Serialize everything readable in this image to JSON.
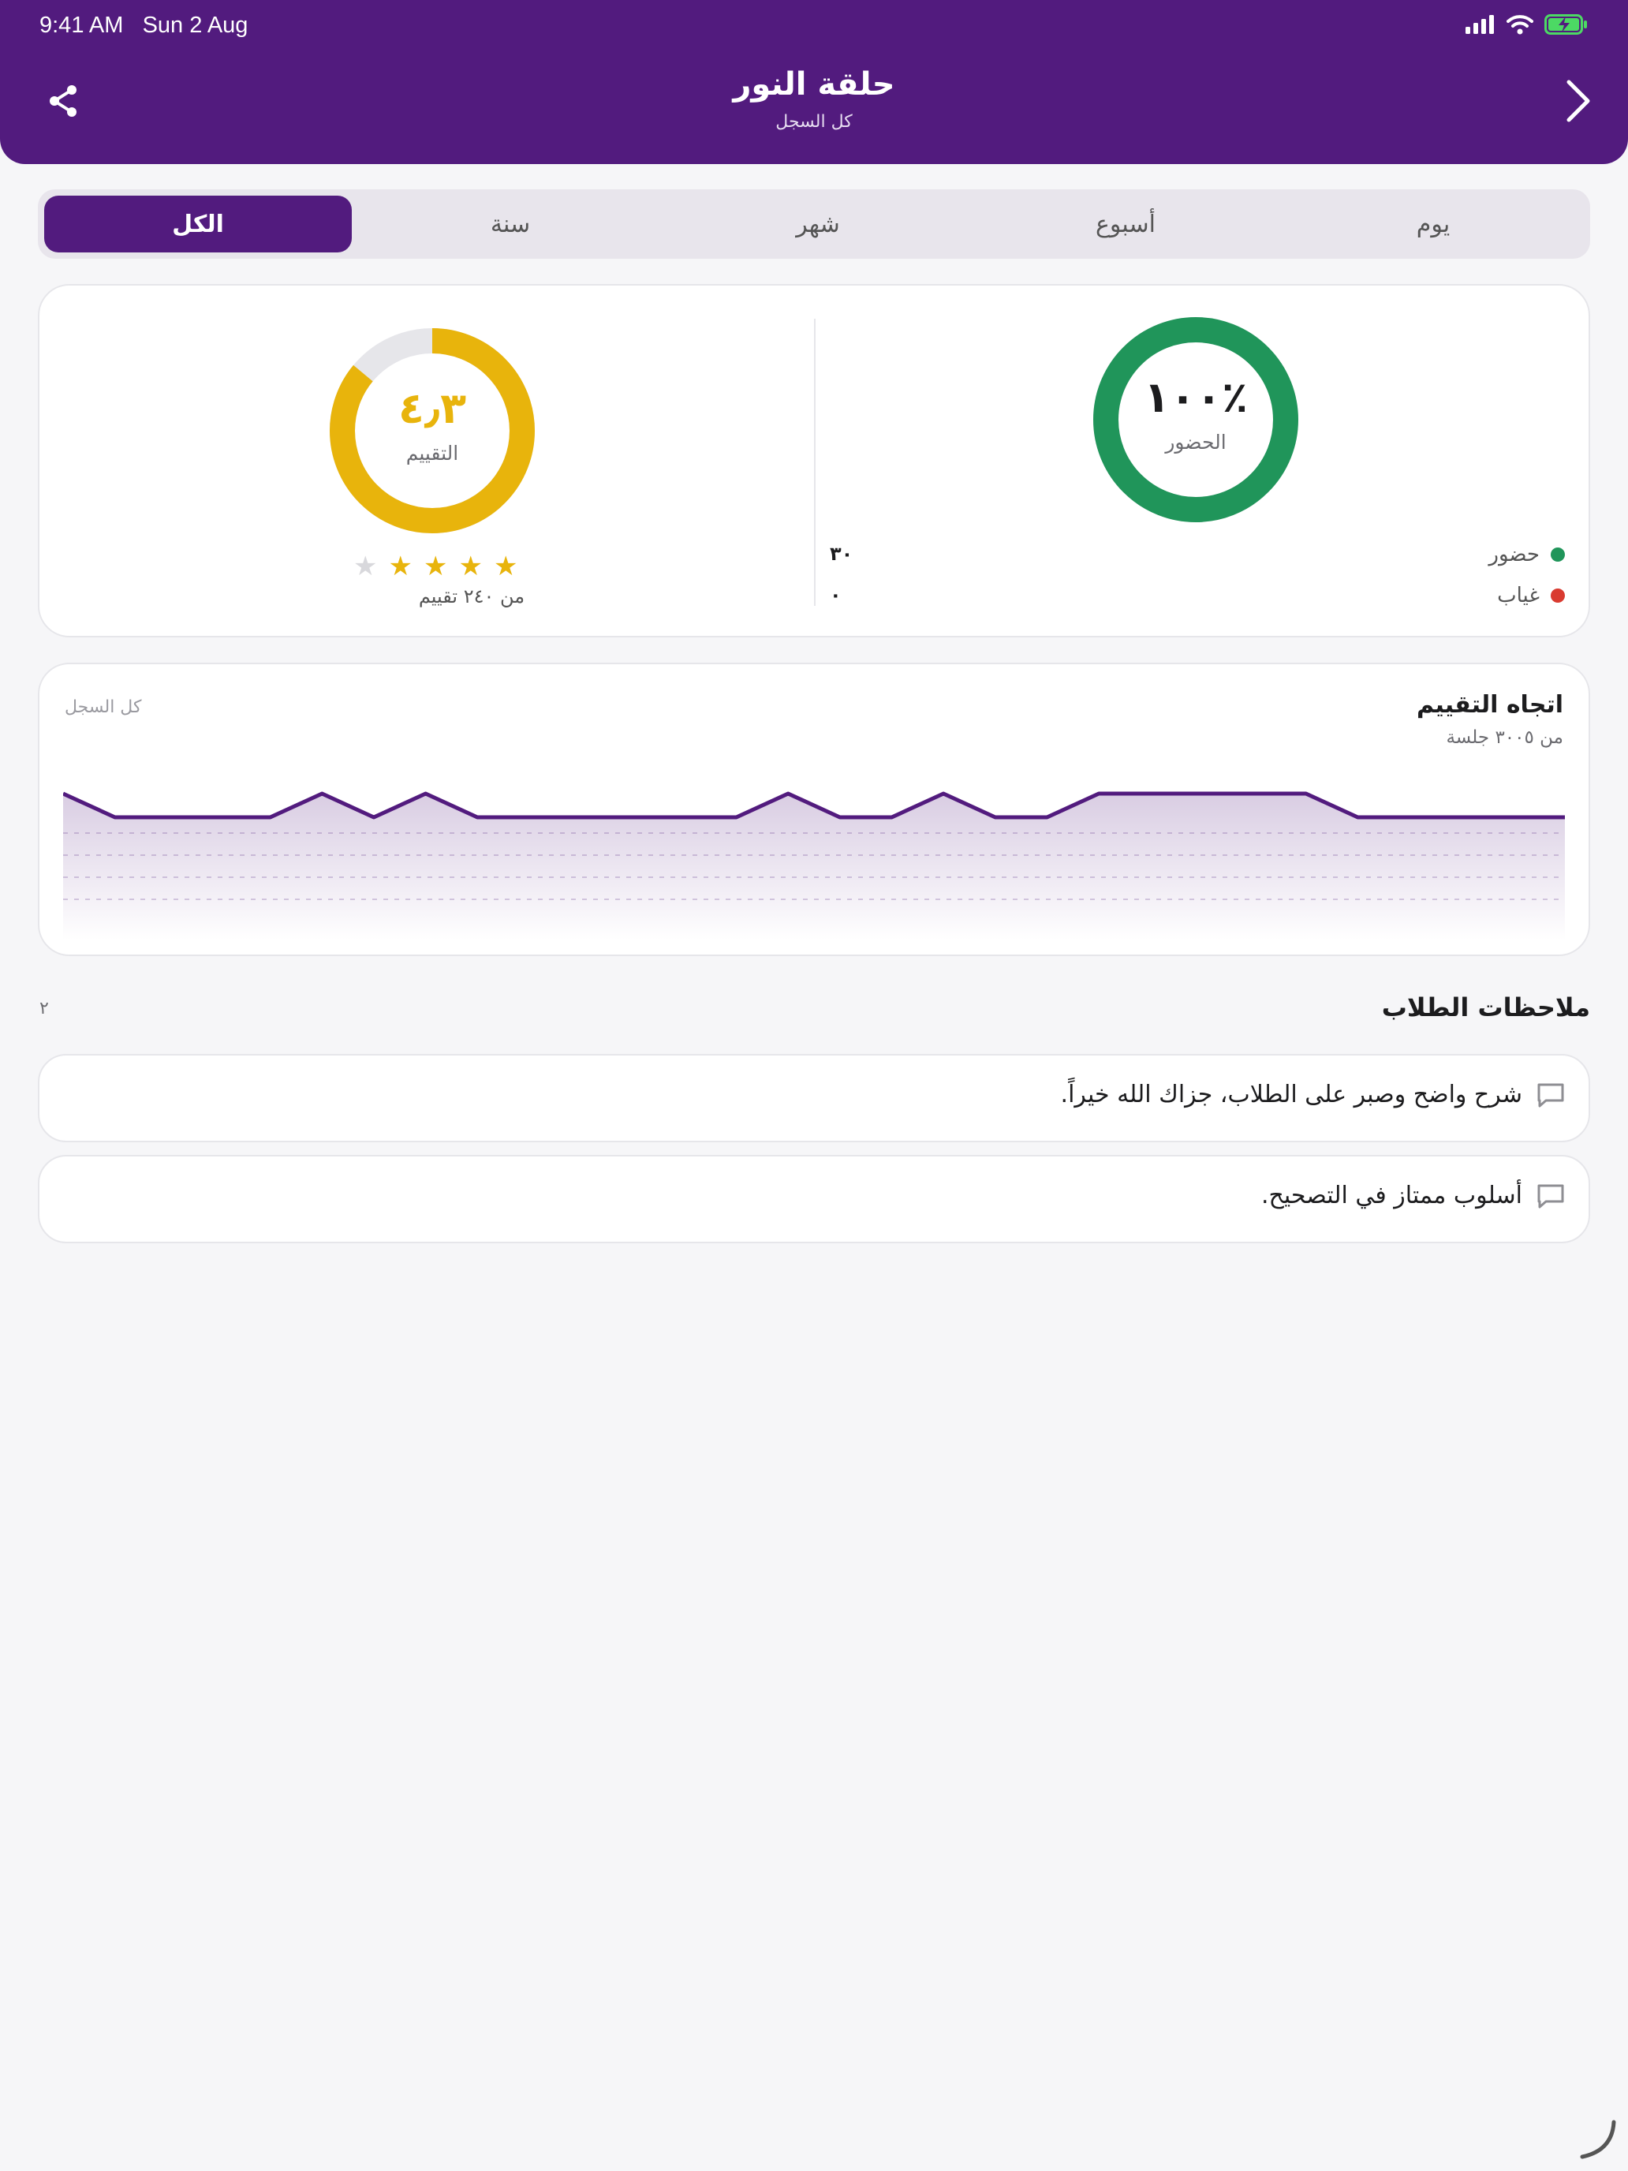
{
  "status_bar": {
    "time": "9:41 AM",
    "date": "Sun 2 Aug"
  },
  "header": {
    "title": "حلقة النور",
    "subtitle": "كل السجل",
    "back_icon": "chevron-right-icon",
    "share_icon": "share-icon"
  },
  "tabs": [
    {
      "label": "يوم",
      "active": false
    },
    {
      "label": "أسبوع",
      "active": false
    },
    {
      "label": "شهر",
      "active": false
    },
    {
      "label": "سنة",
      "active": false
    },
    {
      "label": "الكل",
      "active": true
    }
  ],
  "attendance": {
    "percent_label": "١٠٠٪",
    "caption": "الحضور",
    "present_label": "حضور",
    "present_value": "٣٠",
    "absent_label": "غياب",
    "absent_value": "٠",
    "fill_fraction": 1.0,
    "color": "#20955a",
    "absent_color": "#d93b30"
  },
  "rating": {
    "value_label": "٤٫٣",
    "caption": "التقييم",
    "fill_fraction": 0.86,
    "stars_filled": 4,
    "stars_total": 5,
    "reviews_label": "من ٢٤٠ تقييم",
    "color": "#e8b40c"
  },
  "trend": {
    "title": "اتجاه التقييم",
    "subtitle": "من ٣٠٠٥ جلسة",
    "range_label": "كل السجل",
    "line_color": "#521b7e"
  },
  "chart_data": {
    "type": "area",
    "title": "اتجاه التقييم",
    "values": [
      5,
      4,
      4,
      4,
      4,
      5,
      4,
      5,
      4,
      4,
      4,
      4,
      4,
      4,
      5,
      4,
      4,
      5,
      4,
      4,
      5,
      5,
      5,
      5,
      5,
      4,
      4,
      4,
      4,
      4
    ]
  },
  "notes": {
    "title": "ملاحظات الطلاب",
    "count": "٢",
    "items": [
      {
        "text": "شرح واضح وصبر على الطلاب، جزاك الله خيراً."
      },
      {
        "text": "أسلوب ممتاز في التصحيح."
      }
    ]
  },
  "colors": {
    "brand": "#521b7e",
    "background": "#f6f6f8"
  }
}
